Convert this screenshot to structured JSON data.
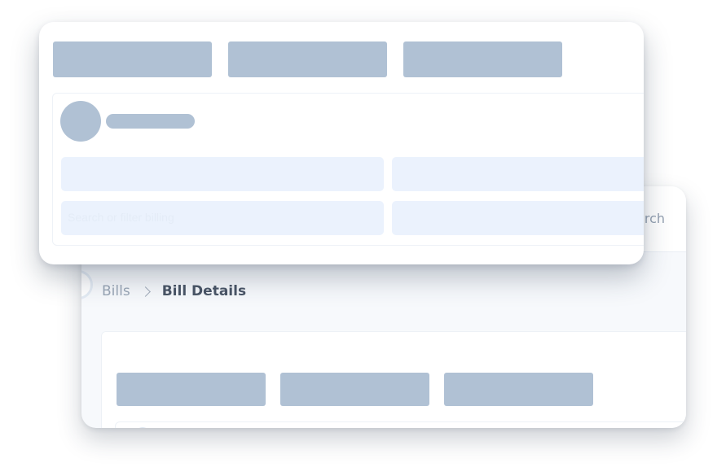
{
  "colors": {
    "skeleton": "#b0c1d4",
    "field": "#ebf2fd",
    "card": "#ffffff",
    "backdrop": "#f7f9fc"
  },
  "back_card": {
    "search": {
      "label": "Search",
      "visible_text": "arch"
    },
    "breadcrumb": {
      "parent": "Bills",
      "separator_icon": "chevron-right-icon",
      "current": "Bill Details"
    },
    "tabs": [
      {
        "state": "loading"
      },
      {
        "state": "loading"
      },
      {
        "state": "loading"
      }
    ]
  },
  "front_card": {
    "tabs": [
      {
        "state": "loading"
      },
      {
        "state": "loading"
      },
      {
        "state": "loading"
      }
    ],
    "profile": {
      "avatar": "avatar-placeholder",
      "name_state": "loading"
    },
    "fields": [
      {
        "text": ""
      },
      {
        "text": ""
      },
      {
        "text": "Search or filter billing"
      },
      {
        "text": ""
      }
    ]
  }
}
